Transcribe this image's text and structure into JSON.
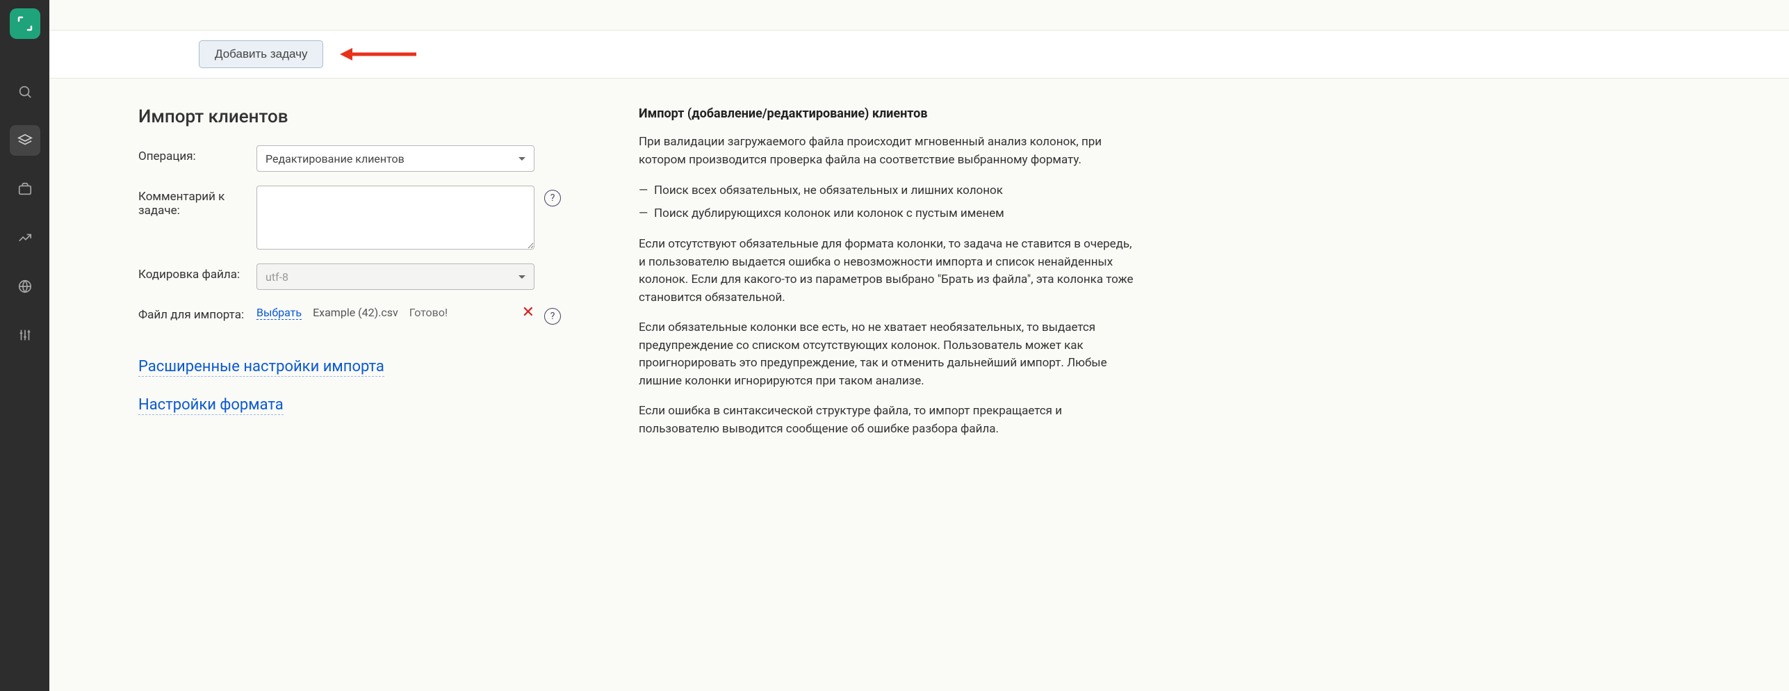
{
  "toolbar": {
    "add_task": "Добавить задачу"
  },
  "page": {
    "title": "Импорт клиентов"
  },
  "form": {
    "operation_label": "Операция:",
    "operation_value": "Редактирование клиентов",
    "comment_label": "Комментарий к задаче:",
    "comment_value": "",
    "encoding_label": "Кодировка файла:",
    "encoding_value": "utf-8",
    "file_label": "Файл для импорта:",
    "file_choose": "Выбрать",
    "file_name": "Example (42).csv",
    "file_status": "Готово!"
  },
  "sections": {
    "advanced": "Расширенные настройки импорта",
    "format": "Настройки формата"
  },
  "help": {
    "title": "Импорт (добавление/редактирование) клиентов",
    "p1": "При валидации загружаемого файла происходит мгновенный анализ колонок, при котором производится проверка файла на соответствие выбранному формату.",
    "li1": "Поиск всех обязательных, не обязательных и лишних колонок",
    "li2": "Поиск дублирующихся колонок или колонок с пустым именем",
    "p2": "Если отсутствуют обязательные для формата колонки, то задача не ставится в очередь, и пользователю выдается ошибка о невозможности импорта и список ненайденных колонок. Если для какого-то из параметров выбрано \"Брать из файла\", эта колонка тоже становится обязательной.",
    "p3": "Если обязательные колонки все есть, но не хватает необязательных, то выдается предупреждение со списком отсутствующих колонок. Пользователь может как проигнорировать это предупреждение, так и отменить дальнейший импорт. Любые лишние колонки игнорируются при таком анализе.",
    "p4": "Если ошибка в синтаксической структуре файла, то импорт прекращается и пользователю выводится сообщение об ошибке разбора файла."
  }
}
